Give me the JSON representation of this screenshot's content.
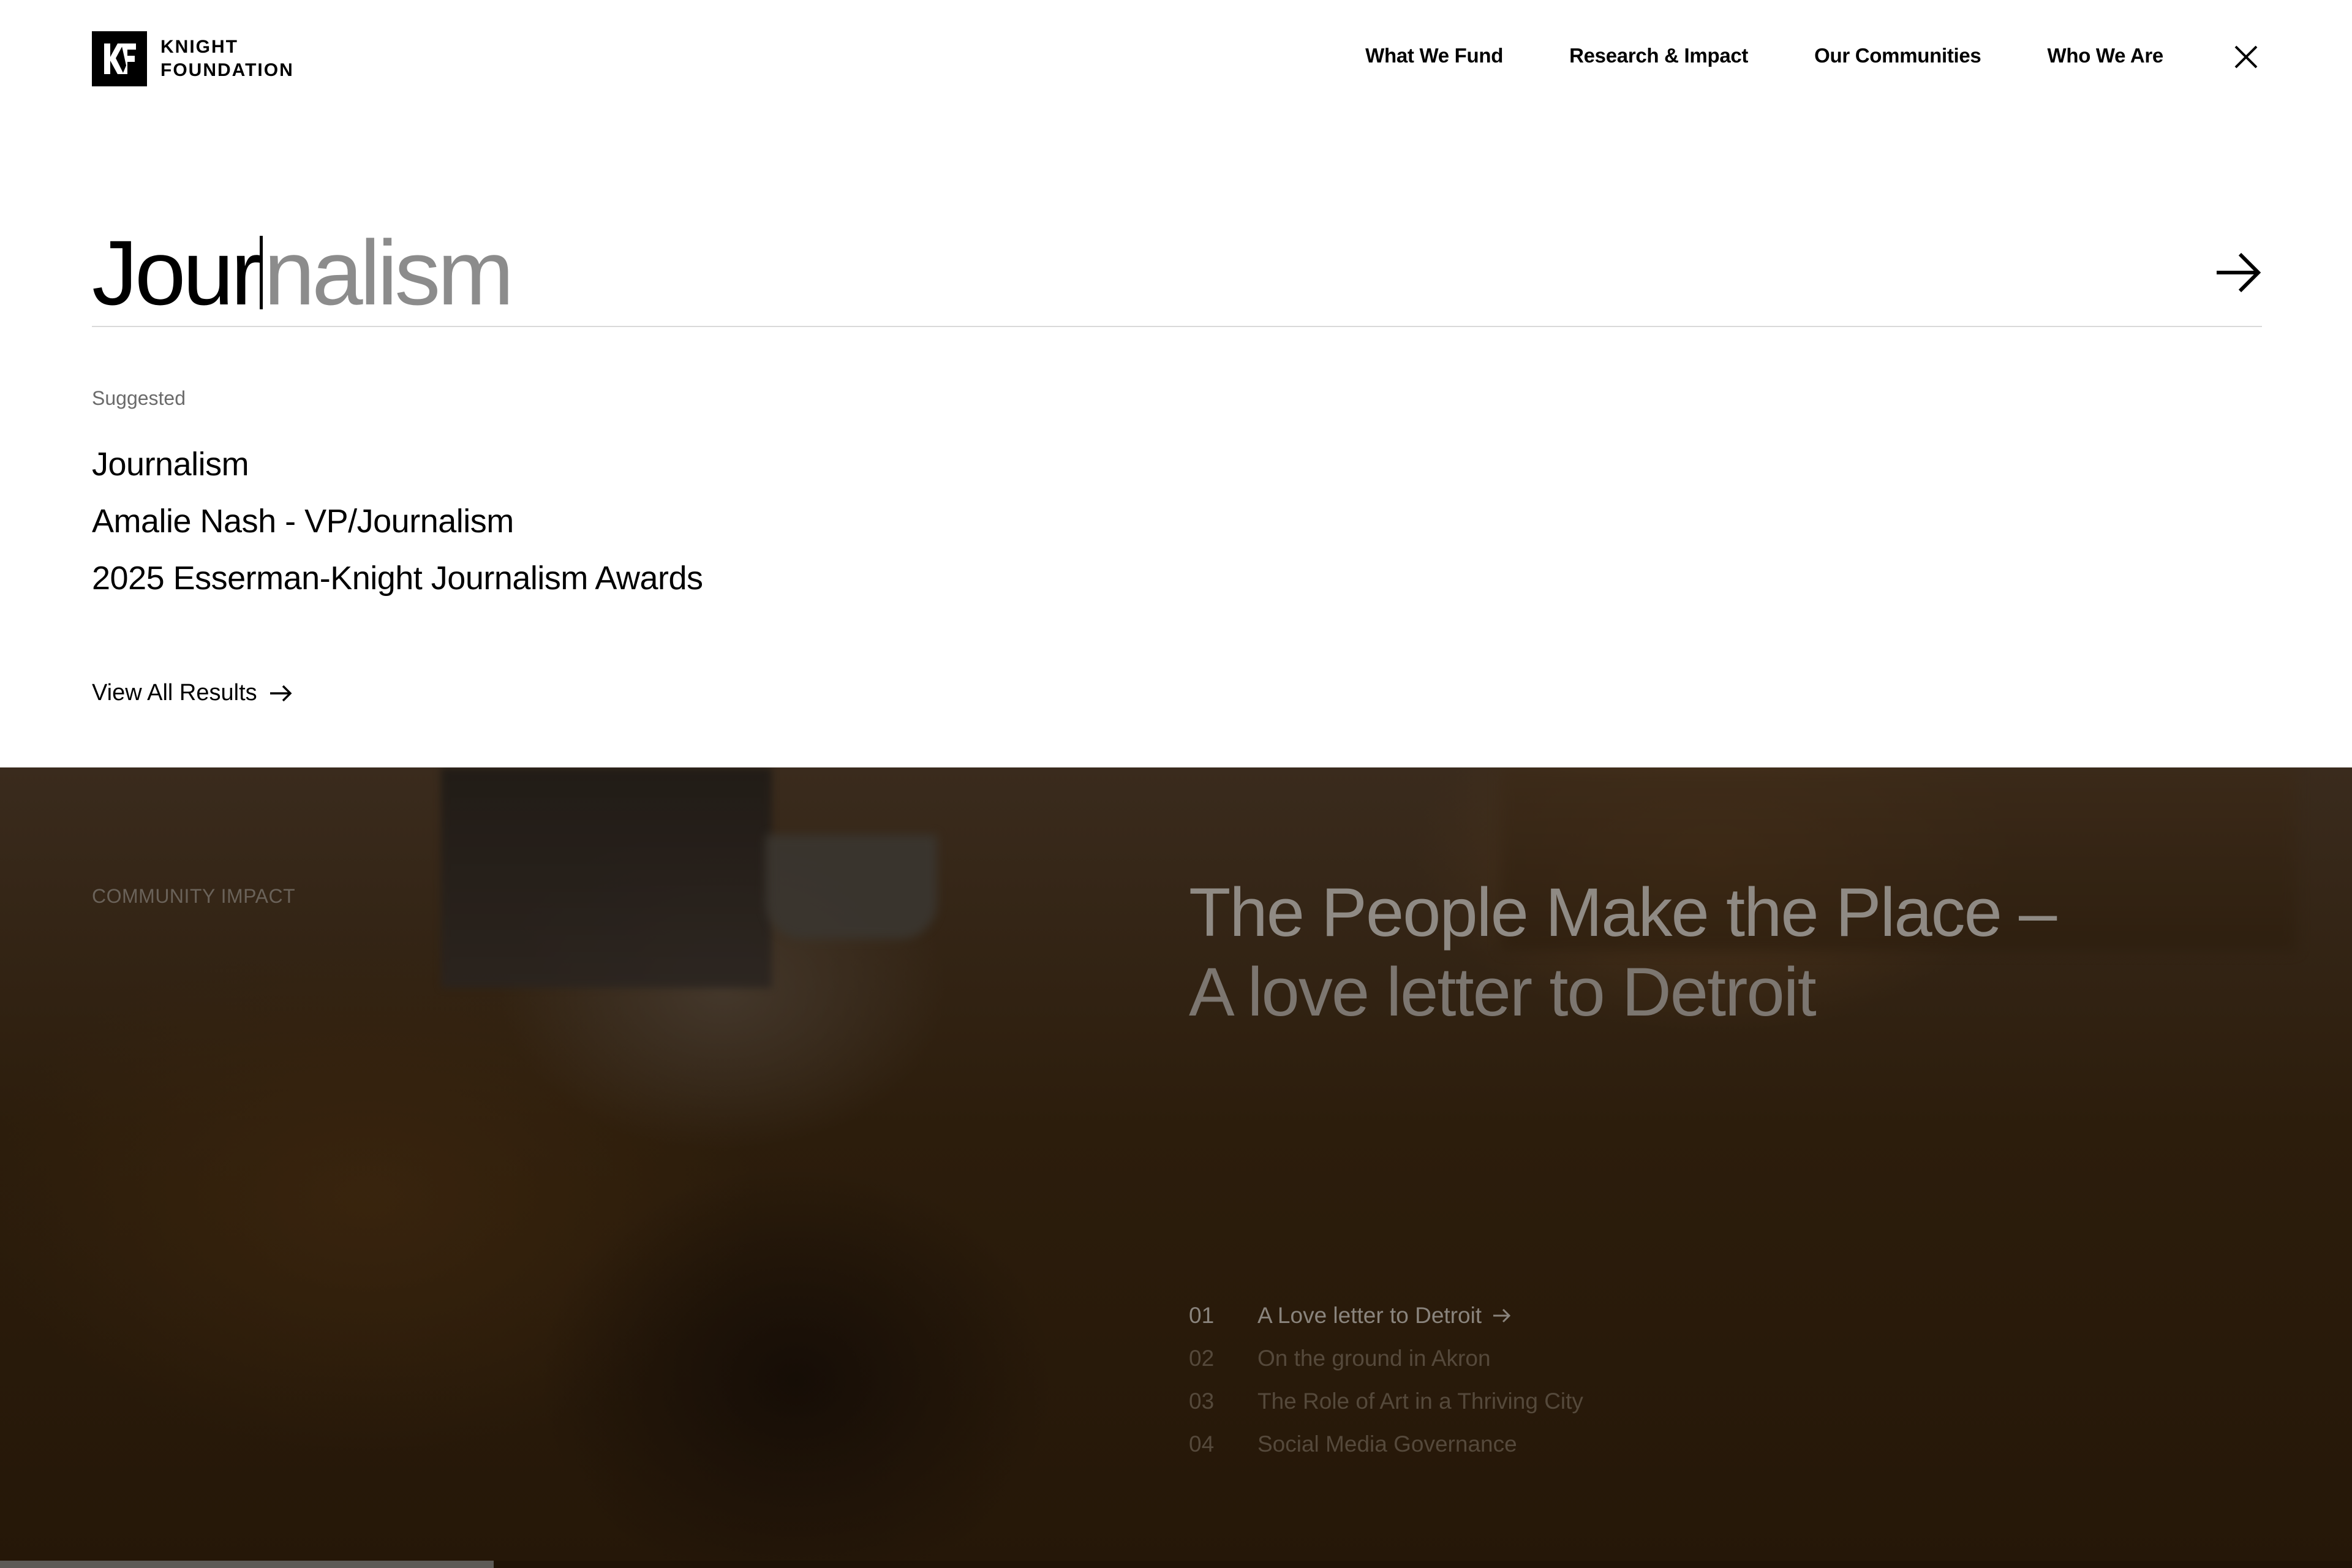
{
  "brand": {
    "line1": "KNIGHT",
    "line2": "FOUNDATION",
    "icon": "kf-logo-mark"
  },
  "nav": {
    "items": [
      {
        "label": "What We Fund"
      },
      {
        "label": "Research & Impact"
      },
      {
        "label": "Our Communities"
      },
      {
        "label": "Who We Are"
      }
    ],
    "close_icon": "close-icon"
  },
  "search": {
    "typed": "Jour",
    "completion": "nalism",
    "submit_icon": "arrow-right-icon",
    "suggested_label": "Suggested",
    "suggestions": [
      "Journalism",
      "Amalie Nash - VP/Journalism",
      "2025 Esserman-Knight Journalism Awards"
    ],
    "view_all_label": "View All Results"
  },
  "hero": {
    "tag": "COMMUNITY IMPACT",
    "title_line1": "The People Make the Place –",
    "title_line2": "A love letter to Detroit",
    "stories": [
      {
        "num": "01",
        "title": "A Love letter to Detroit",
        "active": true
      },
      {
        "num": "02",
        "title": "On the ground in Akron",
        "active": false
      },
      {
        "num": "03",
        "title": "The Role of Art in a Thriving City",
        "active": false
      },
      {
        "num": "04",
        "title": "Social Media Governance",
        "active": false
      }
    ],
    "progress": 0.21
  },
  "colors": {
    "text": "#000000",
    "completion": "#8c8c8c",
    "label": "#6b6b6b",
    "hero_bg": "#2c1d0c",
    "hero_title": "#8f8a84"
  }
}
